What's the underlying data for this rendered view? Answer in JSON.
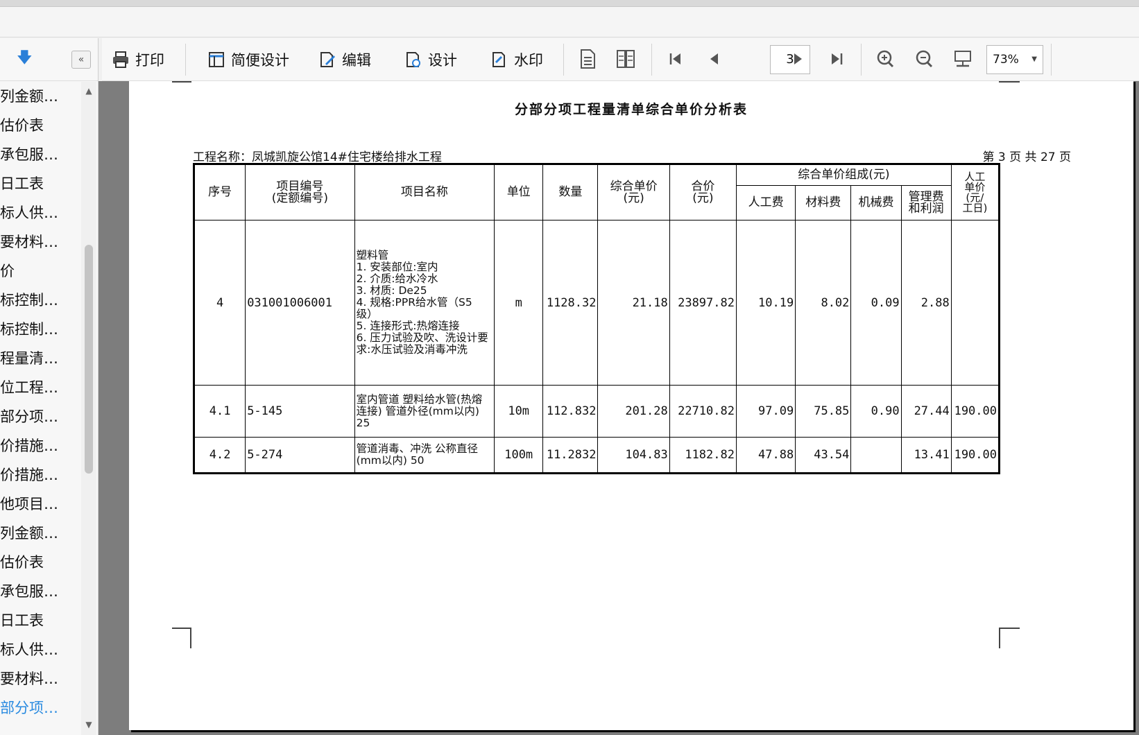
{
  "sidebar": {
    "items": [
      "列金额…",
      "估价表",
      "承包服…",
      "日工表",
      "标人供…",
      "要材料…",
      "价",
      "标控制…",
      "标控制…",
      "程量清…",
      "位工程…",
      "部分项…",
      "价措施…",
      "价措施…",
      "他项目…",
      "列金额…",
      "估价表",
      "承包服…",
      "日工表",
      "标人供…",
      "要材料…",
      "部分项…"
    ],
    "active_index": 21
  },
  "toolbar": {
    "print": "打印",
    "simple_design": "简便设计",
    "edit": "编辑",
    "design": "设计",
    "watermark": "水印",
    "page_value": "3",
    "zoom_value": "73%"
  },
  "document": {
    "title": "分部分项工程量清单综合单价分析表",
    "project": "工程名称：凤城凯旋公馆14#住宅楼给排水工程",
    "page_info": "第 3 页  共 27 页",
    "headers": {
      "seq": "序号",
      "code": "项目编号\n(定额编号)",
      "name": "项目名称",
      "unit": "单位",
      "qty": "数量",
      "unit_price": "综合单价\n(元)",
      "total": "合价\n(元)",
      "composition": "综合单价组成(元)",
      "labor": "人工费",
      "material": "材料费",
      "machine": "机械费",
      "mgmt": "管理费\n和利润",
      "labor_rate": "人工\n单价\n(元/\n工日)"
    },
    "rows": [
      {
        "seq": "4",
        "code": "031001006001",
        "name": "塑料管\n1. 安装部位:室内\n2. 介质:给水冷水\n3. 材质: De25\n4. 规格:PPR给水管（S5级）\n5. 连接形式:热熔连接\n6. 压力试验及吹、洗设计要求:水压试验及消毒冲洗",
        "unit": "m",
        "qty": "1128.32",
        "unit_price": "21.18",
        "total": "23897.82",
        "labor": "10.19",
        "material": "8.02",
        "machine": "0.09",
        "mgmt": "2.88",
        "rate": ""
      },
      {
        "seq": "4.1",
        "code": "5-145",
        "name": "室内管道 塑料给水管(热熔连接) 管道外径(mm以内) 25",
        "unit": "10m",
        "qty": "112.832",
        "unit_price": "201.28",
        "total": "22710.82",
        "labor": "97.09",
        "material": "75.85",
        "machine": "0.90",
        "mgmt": "27.44",
        "rate": "190.00"
      },
      {
        "seq": "4.2",
        "code": "5-274",
        "name": "管道消毒、冲洗 公称直径(mm以内) 50",
        "unit": "100m",
        "qty": "11.2832",
        "unit_price": "104.83",
        "total": "1182.82",
        "labor": "47.88",
        "material": "43.54",
        "machine": "",
        "mgmt": "13.41",
        "rate": "190.00"
      }
    ]
  }
}
